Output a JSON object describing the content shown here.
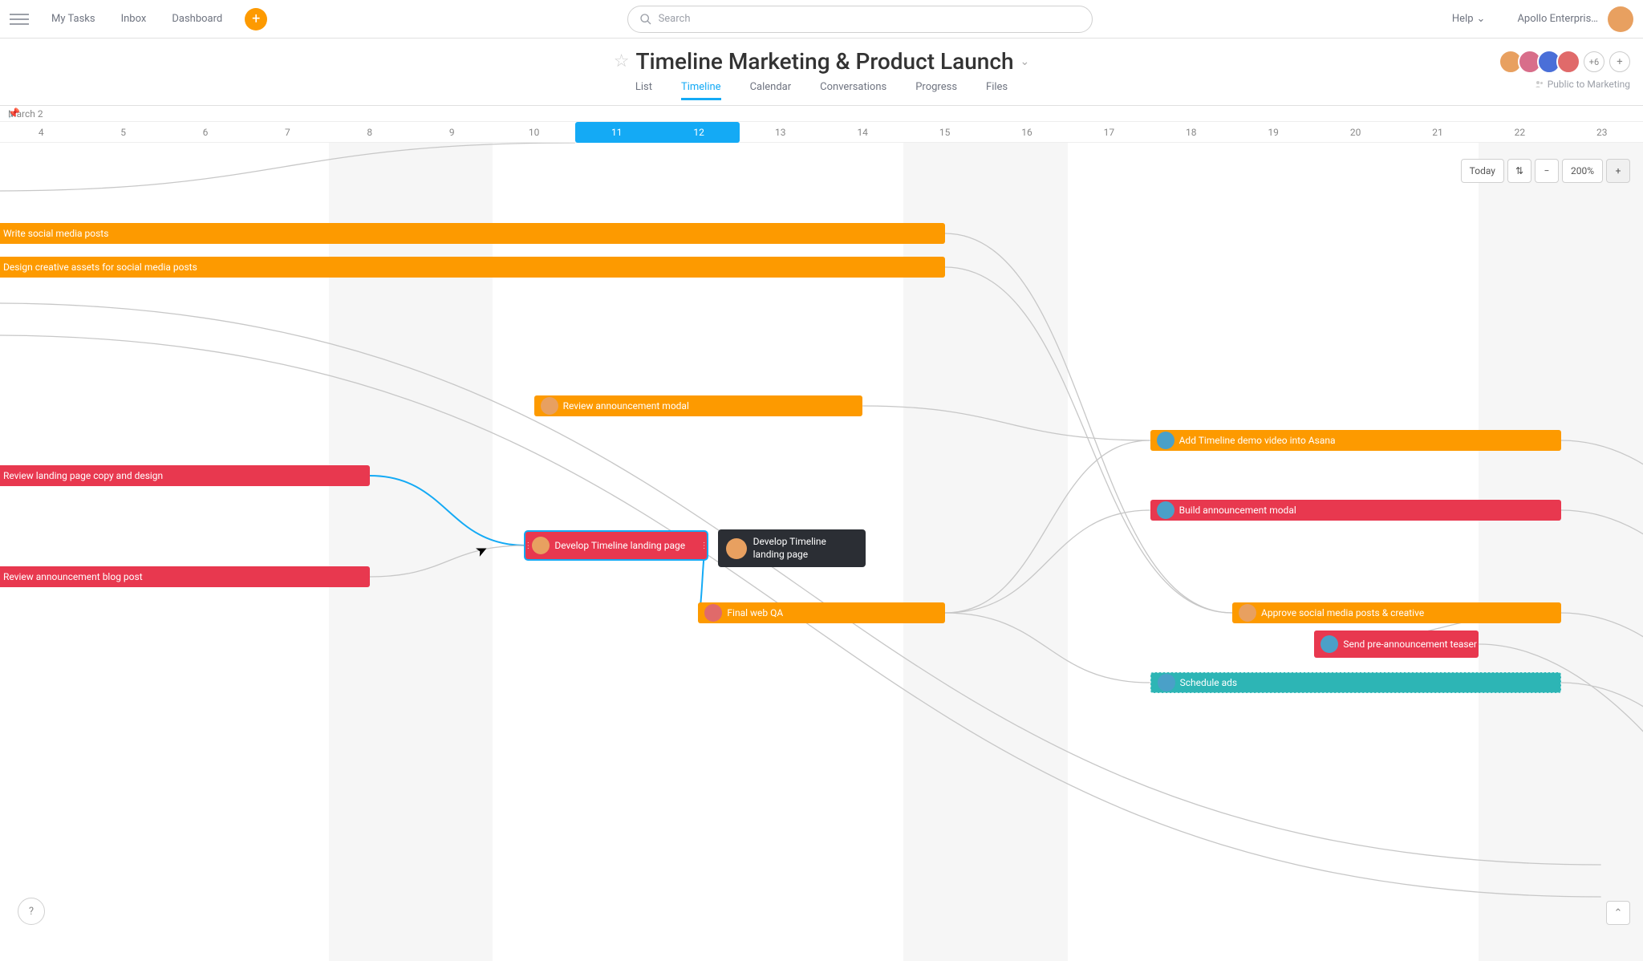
{
  "nav": {
    "my_tasks": "My Tasks",
    "inbox": "Inbox",
    "dashboard": "Dashboard"
  },
  "search": {
    "placeholder": "Search"
  },
  "help_label": "Help",
  "org_name": "Apollo Enterpris…",
  "project": {
    "title": "Timeline Marketing & Product Launch",
    "members_more": "+6",
    "privacy": "Public to Marketing"
  },
  "tabs": {
    "list": "List",
    "timeline": "Timeline",
    "calendar": "Calendar",
    "conversations": "Conversations",
    "progress": "Progress",
    "files": "Files"
  },
  "timeline": {
    "month_label": "March 2",
    "days": [
      4,
      5,
      6,
      7,
      8,
      9,
      10,
      11,
      12,
      13,
      14,
      15,
      16,
      17,
      18,
      19,
      20,
      21,
      22,
      23
    ],
    "today_range": [
      11,
      12
    ],
    "weekends": [
      [
        8,
        9
      ],
      [
        15,
        16
      ],
      [
        22,
        23
      ]
    ],
    "today_btn": "Today",
    "zoom": "200%"
  },
  "tasks": {
    "t0": "Write social media posts",
    "t1": "Design creative assets for social media posts",
    "t2": "Review announcement modal",
    "t3": "Add Timeline demo video into Asana",
    "t4": "Review landing page copy and design",
    "t5": "Build announcement modal",
    "t6": "Review announcement blog post",
    "t7": "Develop Timeline landing page",
    "t8": "Final web QA",
    "t9": "Approve social media posts & creative",
    "t10": "Send pre-announcement teaser email",
    "t11": "Schedule ads"
  },
  "tooltip": {
    "text": "Develop Timeline landing page"
  }
}
